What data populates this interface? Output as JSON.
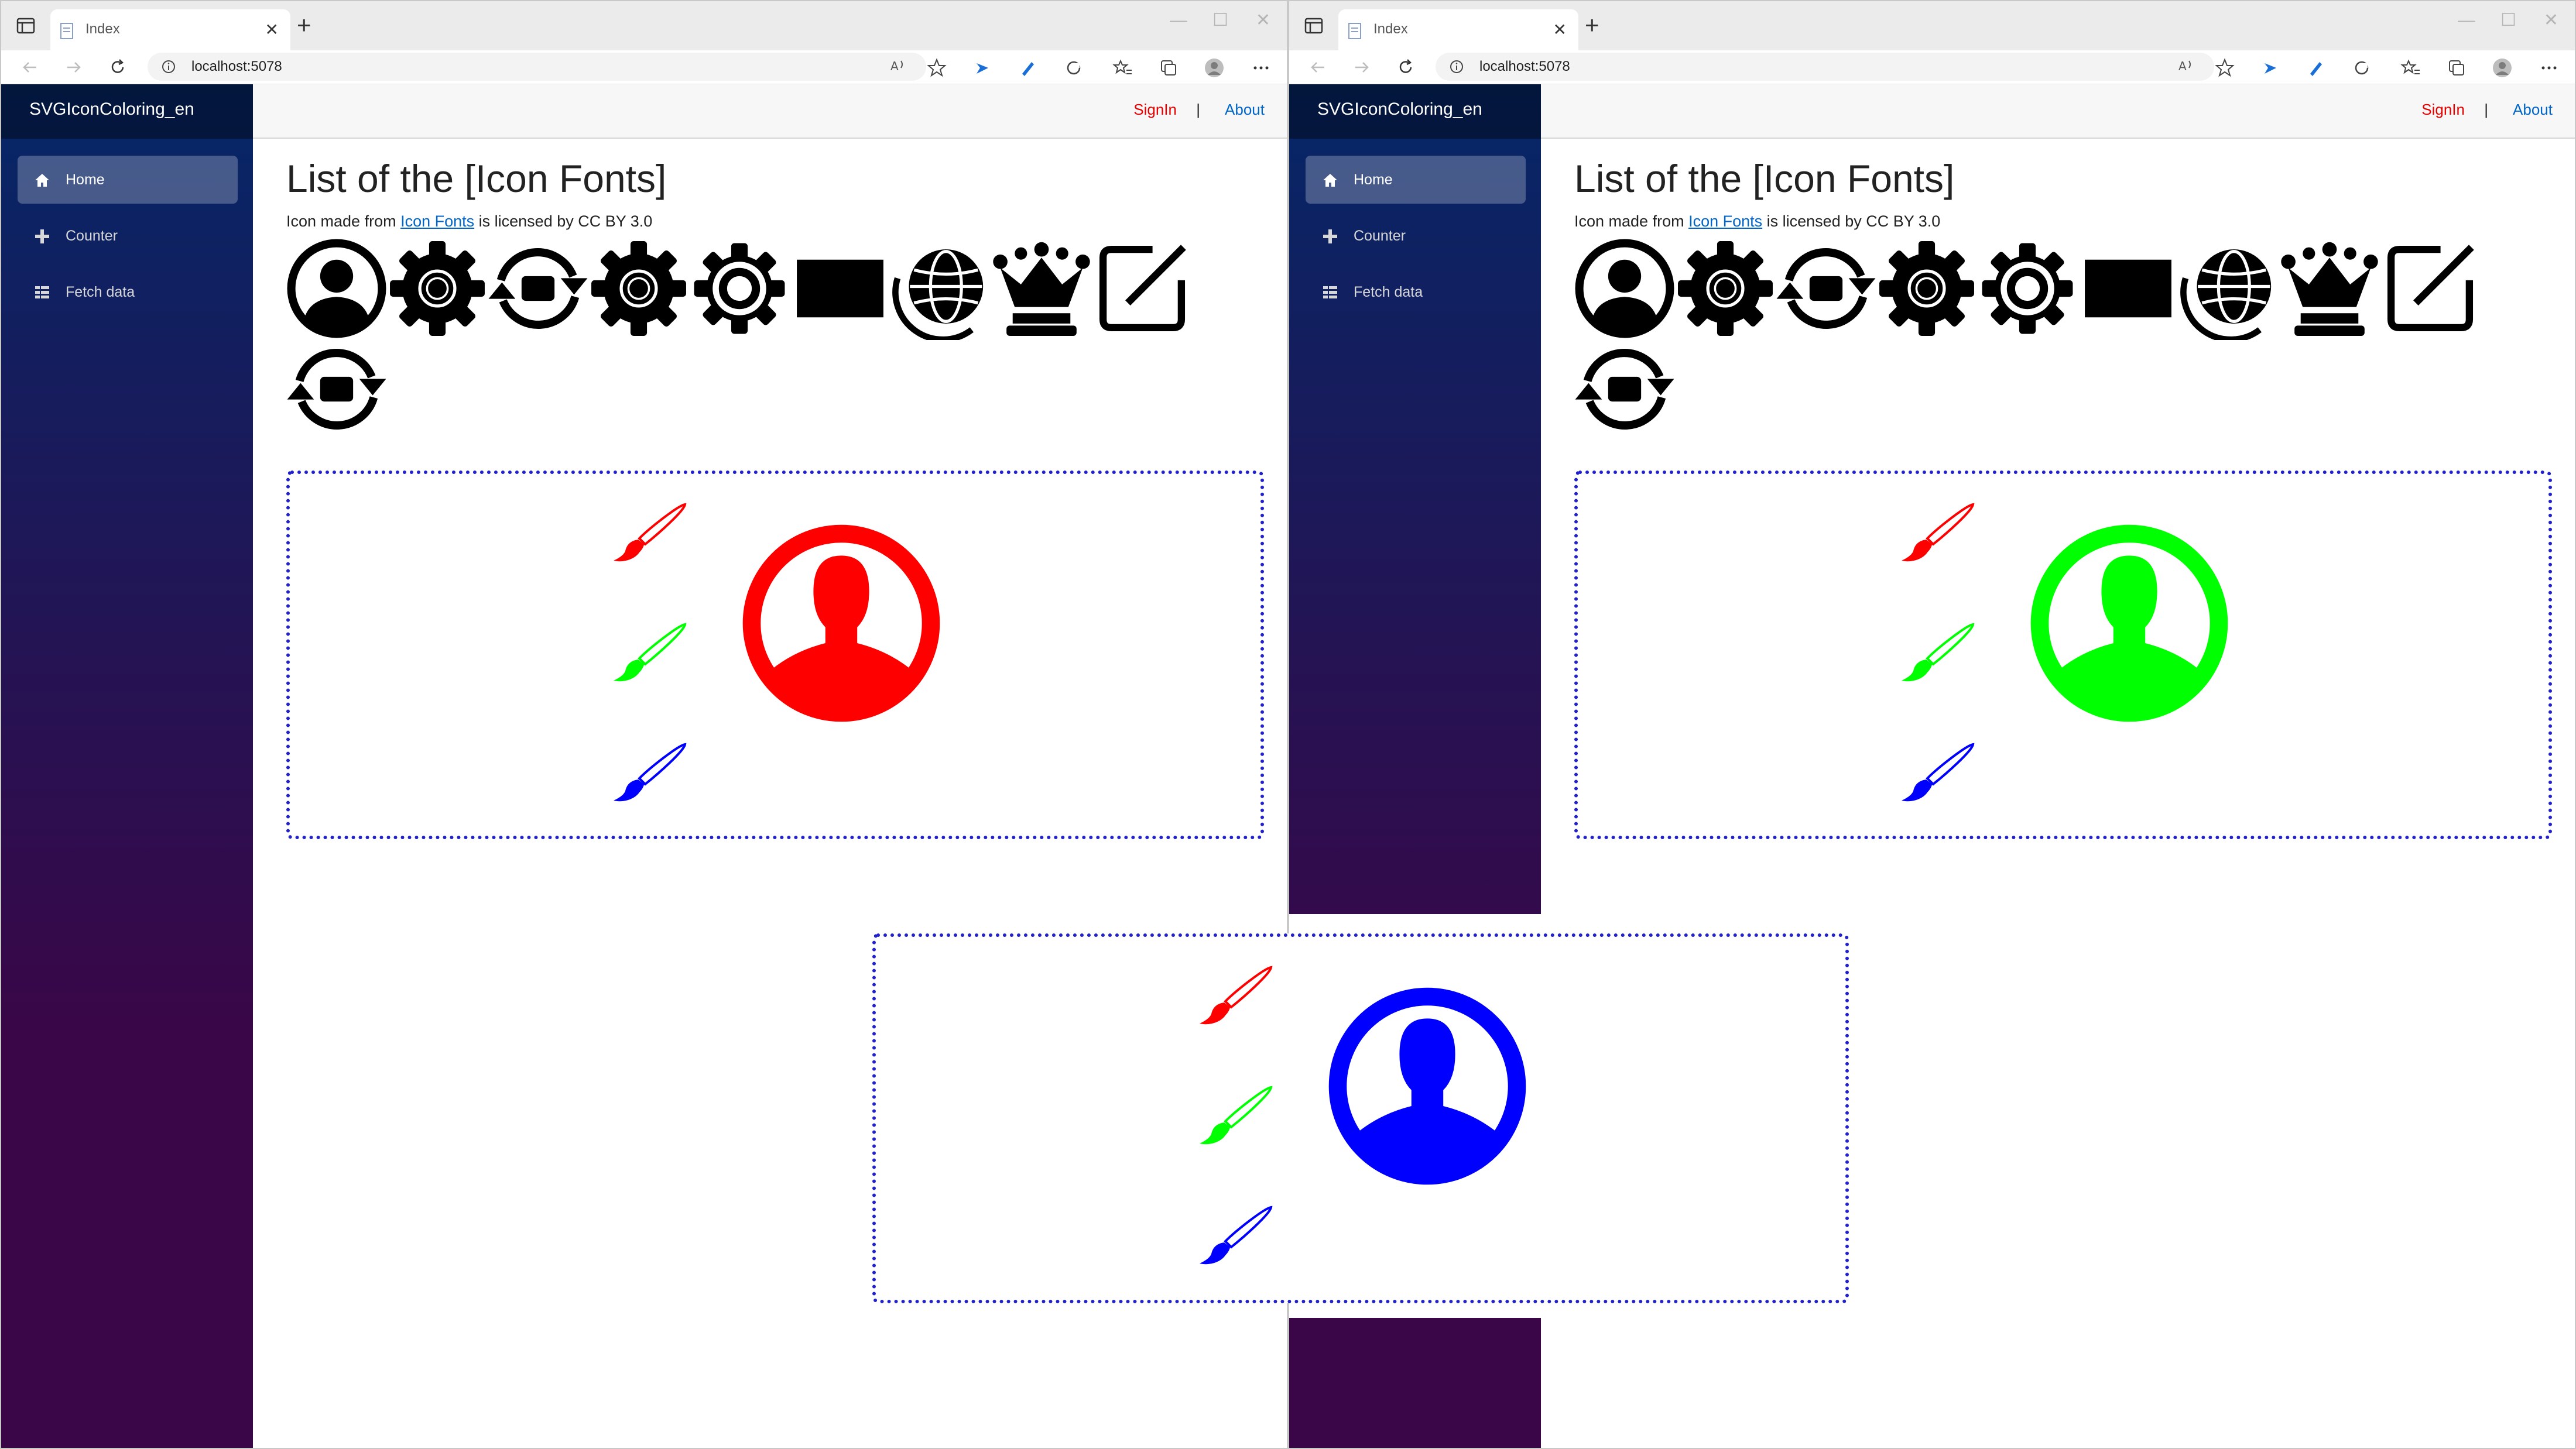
{
  "browser": {
    "tab_title": "Index",
    "url": "localhost:5078"
  },
  "app": {
    "brand": "SVGIconColoring_en",
    "nav": [
      {
        "label": "Home",
        "icon": "home-icon",
        "active": true
      },
      {
        "label": "Counter",
        "icon": "plus-icon",
        "active": false
      },
      {
        "label": "Fetch data",
        "icon": "list-icon",
        "active": false
      }
    ],
    "topbar": {
      "signin": "SignIn",
      "separator": "|",
      "about": "About"
    },
    "heading": "List of the [Icon Fonts]",
    "credit": {
      "prefix": "Icon made from ",
      "link": "Icon Fonts",
      "suffix": " is licensed by CC BY 3.0"
    },
    "icon_list": [
      "user-circle-icon",
      "gear-icon",
      "refresh-icon",
      "gear-icon",
      "gear-outline-icon",
      "square-icon",
      "globe-icon",
      "crown-icon",
      "edit-icon",
      "refresh-icon"
    ]
  },
  "coloring": {
    "brush_colors": [
      "#ff0000",
      "#00ff00",
      "#0000ff"
    ],
    "left_window_avatar_color": "#ff0000",
    "right_window_avatar_color": "#00ff00",
    "overlay_avatar_color": "#0000ff",
    "box_border_color": "#2222cc"
  }
}
